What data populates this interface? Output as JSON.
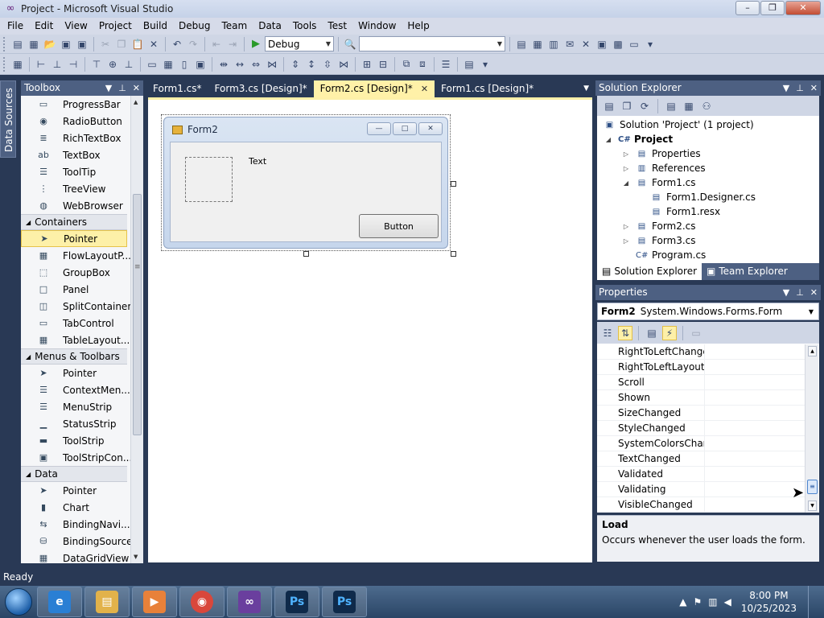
{
  "window": {
    "title": "Project - Microsoft Visual Studio",
    "controls": {
      "minimize": "–",
      "restore": "❐",
      "close": "✕"
    }
  },
  "menu": [
    "File",
    "Edit",
    "View",
    "Project",
    "Build",
    "Debug",
    "Team",
    "Data",
    "Tools",
    "Test",
    "Window",
    "Help"
  ],
  "toolbar": {
    "config_value": "Debug",
    "platform_value": ""
  },
  "side_strip": {
    "label": "Data Sources"
  },
  "toolbox": {
    "title": "Toolbox",
    "rows": [
      {
        "kind": "item",
        "label": "ProgressBar",
        "icon": "▭"
      },
      {
        "kind": "item",
        "label": "RadioButton",
        "icon": "◉"
      },
      {
        "kind": "item",
        "label": "RichTextBox",
        "icon": "≣"
      },
      {
        "kind": "item",
        "label": "TextBox",
        "icon": "ab"
      },
      {
        "kind": "item",
        "label": "ToolTip",
        "icon": "☰"
      },
      {
        "kind": "item",
        "label": "TreeView",
        "icon": "⋮"
      },
      {
        "kind": "item",
        "label": "WebBrowser",
        "icon": "◍"
      },
      {
        "kind": "cat",
        "label": "Containers"
      },
      {
        "kind": "item",
        "label": "Pointer",
        "icon": "➤",
        "selected": true
      },
      {
        "kind": "item",
        "label": "FlowLayoutP...",
        "icon": "▦"
      },
      {
        "kind": "item",
        "label": "GroupBox",
        "icon": "⬚"
      },
      {
        "kind": "item",
        "label": "Panel",
        "icon": "□"
      },
      {
        "kind": "item",
        "label": "SplitContainer",
        "icon": "◫"
      },
      {
        "kind": "item",
        "label": "TabControl",
        "icon": "▭"
      },
      {
        "kind": "item",
        "label": "TableLayout...",
        "icon": "▦"
      },
      {
        "kind": "cat",
        "label": "Menus & Toolbars"
      },
      {
        "kind": "item",
        "label": "Pointer",
        "icon": "➤"
      },
      {
        "kind": "item",
        "label": "ContextMen...",
        "icon": "☰"
      },
      {
        "kind": "item",
        "label": "MenuStrip",
        "icon": "☰"
      },
      {
        "kind": "item",
        "label": "StatusStrip",
        "icon": "▁"
      },
      {
        "kind": "item",
        "label": "ToolStrip",
        "icon": "▬"
      },
      {
        "kind": "item",
        "label": "ToolStripCon...",
        "icon": "▣"
      },
      {
        "kind": "cat",
        "label": "Data"
      },
      {
        "kind": "item",
        "label": "Pointer",
        "icon": "➤"
      },
      {
        "kind": "item",
        "label": "Chart",
        "icon": "▮"
      },
      {
        "kind": "item",
        "label": "BindingNavi...",
        "icon": "⇆"
      },
      {
        "kind": "item",
        "label": "BindingSource",
        "icon": "⛁"
      },
      {
        "kind": "item",
        "label": "DataGridView",
        "icon": "▦"
      }
    ]
  },
  "tabs": [
    {
      "label": "Form1.cs*",
      "active": false
    },
    {
      "label": "Form3.cs [Design]*",
      "active": false
    },
    {
      "label": "Form2.cs [Design]*",
      "active": true
    },
    {
      "label": "Form1.cs [Design]*",
      "active": false
    }
  ],
  "designer": {
    "form_title": "Form2",
    "label_text": "Text",
    "button_text": "Button"
  },
  "solution_explorer": {
    "title": "Solution Explorer",
    "nodes": [
      {
        "label": "Solution 'Project' (1 project)",
        "level": 0,
        "exp": "",
        "icon": "▣",
        "bold": false
      },
      {
        "label": "Project",
        "level": 0,
        "exp": "◢",
        "icon": "C#",
        "bold": true
      },
      {
        "label": "Properties",
        "level": 1,
        "exp": "▷",
        "icon": "▤",
        "bold": false
      },
      {
        "label": "References",
        "level": 1,
        "exp": "▷",
        "icon": "▥",
        "bold": false
      },
      {
        "label": "Form1.cs",
        "level": 1,
        "exp": "◢",
        "icon": "▤",
        "bold": false
      },
      {
        "label": "Form1.Designer.cs",
        "level": 2,
        "exp": "",
        "icon": "▤",
        "bold": false
      },
      {
        "label": "Form1.resx",
        "level": 2,
        "exp": "",
        "icon": "▤",
        "bold": false
      },
      {
        "label": "Form2.cs",
        "level": 1,
        "exp": "▷",
        "icon": "▤",
        "bold": false
      },
      {
        "label": "Form3.cs",
        "level": 1,
        "exp": "▷",
        "icon": "▤",
        "bold": false
      },
      {
        "label": "Program.cs",
        "level": 1,
        "exp": "",
        "icon": "C#",
        "bold": false
      }
    ],
    "bottom_tabs": [
      "Solution Explorer",
      "Team Explorer"
    ]
  },
  "properties": {
    "title": "Properties",
    "object_name": "Form2",
    "object_type": "System.Windows.Forms.Form",
    "events": [
      "RightToLeftChangec",
      "RightToLeftLayoutC",
      "Scroll",
      "Shown",
      "SizeChanged",
      "StyleChanged",
      "SystemColorsChang",
      "TextChanged",
      "Validated",
      "Validating",
      "VisibleChanged"
    ],
    "desc_title": "Load",
    "desc_text": "Occurs whenever the user loads the form."
  },
  "status": {
    "text": "Ready"
  },
  "taskbar": {
    "time": "8:00 PM",
    "date": "10/25/2023"
  }
}
